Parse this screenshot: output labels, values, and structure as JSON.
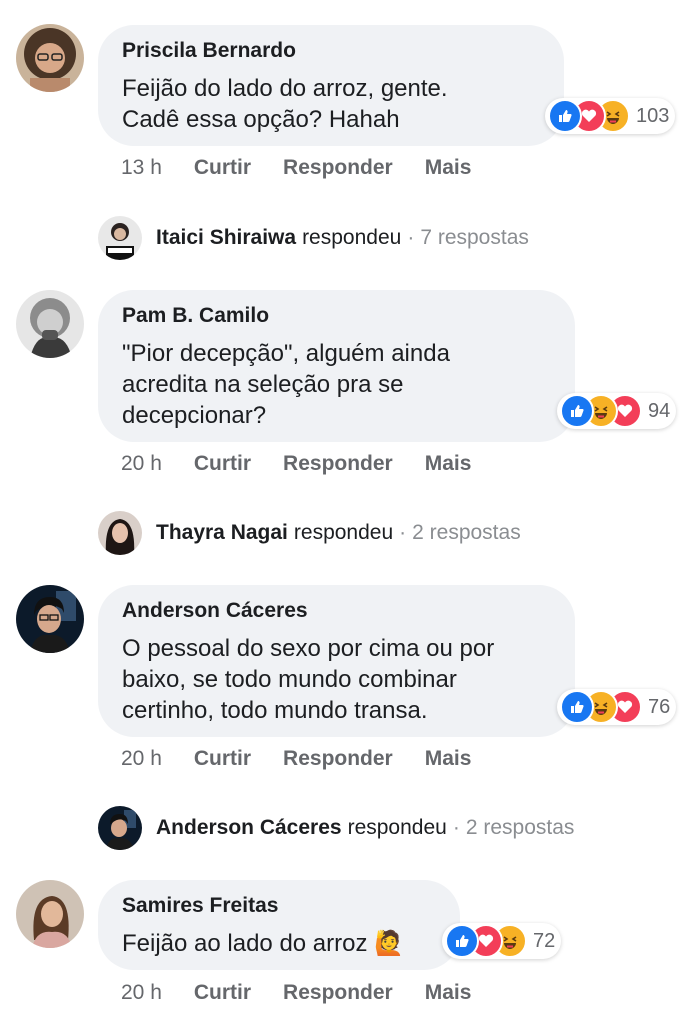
{
  "comments": [
    {
      "author": "Priscila Bernardo",
      "lines": [
        "Feijão do lado do arroz, gente.",
        "Cadê essa opção? Hahah"
      ],
      "reaction_icons": [
        "like-icon",
        "love-icon",
        "haha-icon"
      ],
      "reaction_count": "103",
      "time": "13 h",
      "like_label": "Curtir",
      "reply_label": "Responder",
      "more_label": "Mais",
      "reply": {
        "name": "Itaici Shiraiwa",
        "verb": "respondeu",
        "dot": "·",
        "count": "7 respostas"
      }
    },
    {
      "author": "Pam B. Camilo",
      "lines": [
        "\"Pior decepção\", alguém ainda",
        "acredita na seleção pra se",
        "decepcionar?"
      ],
      "reaction_icons": [
        "like-icon",
        "haha-icon",
        "love-icon"
      ],
      "reaction_count": "94",
      "time": "20 h",
      "like_label": "Curtir",
      "reply_label": "Responder",
      "more_label": "Mais",
      "reply": {
        "name": "Thayra Nagai",
        "verb": "respondeu",
        "dot": "·",
        "count": "2 respostas"
      }
    },
    {
      "author": "Anderson Cáceres",
      "lines": [
        "O pessoal do sexo por cima ou por",
        "baixo, se todo mundo combinar",
        "certinho, todo mundo transa."
      ],
      "reaction_icons": [
        "like-icon",
        "haha-icon",
        "love-icon"
      ],
      "reaction_count": "76",
      "time": "20 h",
      "like_label": "Curtir",
      "reply_label": "Responder",
      "more_label": "Mais",
      "reply": {
        "name": "Anderson Cáceres",
        "verb": "respondeu",
        "dot": "·",
        "count": "2 respostas"
      }
    },
    {
      "author": "Samires Freitas",
      "lines": [
        "Feijão ao lado do arroz 🙋"
      ],
      "reaction_icons": [
        "like-icon",
        "love-icon",
        "haha-icon"
      ],
      "reaction_count": "72",
      "time": "20 h",
      "like_label": "Curtir",
      "reply_label": "Responder",
      "more_label": "Mais"
    }
  ],
  "colors": {
    "like": "#1877f2",
    "love": "#f33e58",
    "haha": "#f7b125",
    "bubble": "#f0f2f5",
    "secondary_text": "#65676b"
  }
}
